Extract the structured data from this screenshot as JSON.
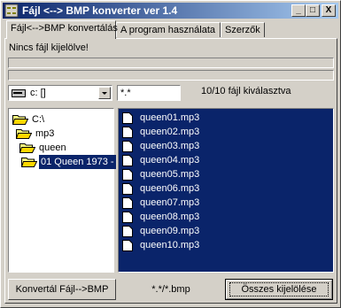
{
  "window": {
    "title": "Fájl <--> BMP  konverter ver 1.4"
  },
  "title_buttons": {
    "minimize": "_",
    "maximize": "□",
    "close": "X"
  },
  "tabs": [
    {
      "label": "Fájl<-->BMP konvertálás"
    },
    {
      "label": "A program használata"
    },
    {
      "label": "Szerzők"
    }
  ],
  "status_text": "Nincs fájl kijelölve!",
  "drive": {
    "value": "c: []"
  },
  "filter": {
    "value": "*.*"
  },
  "selection_count": "10/10 fájl kiválasztva",
  "directories": [
    {
      "name": "C:\\",
      "icon": "open-folder-icon"
    },
    {
      "name": "mp3",
      "icon": "open-folder-icon"
    },
    {
      "name": "queen",
      "icon": "open-folder-icon"
    },
    {
      "name": "01 Queen 1973 -",
      "icon": "open-folder-icon",
      "selected": true
    }
  ],
  "files": [
    "queen01.mp3",
    "queen02.mp3",
    "queen03.mp3",
    "queen04.mp3",
    "queen05.mp3",
    "queen06.mp3",
    "queen07.mp3",
    "queen08.mp3",
    "queen09.mp3",
    "queen10.mp3"
  ],
  "buttons": {
    "convert": "Konvertál Fájl-->BMP",
    "select_all": "Összes kijelölése"
  },
  "bmp_mask": "*.*/*.bmp",
  "colors": {
    "title_start": "#0a246a",
    "title_end": "#a6caf0",
    "selection": "#0a246a",
    "face": "#d4d0c8"
  }
}
